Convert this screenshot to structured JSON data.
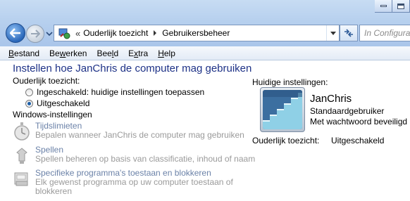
{
  "address": {
    "chevron": "«",
    "crumbs": [
      "Ouderlijk toezicht",
      "Gebruikersbeheer"
    ],
    "search_placeholder": "In Configuratiescherm zoeken"
  },
  "menu": {
    "items": [
      {
        "prefix": "",
        "underline": "B",
        "rest": "estand"
      },
      {
        "prefix": "Be",
        "underline": "w",
        "rest": "erken"
      },
      {
        "prefix": "Bee",
        "underline": "l",
        "rest": "d"
      },
      {
        "prefix": "E",
        "underline": "x",
        "rest": "tra"
      },
      {
        "prefix": "",
        "underline": "H",
        "rest": "elp"
      }
    ]
  },
  "main": {
    "title": "Instellen hoe JanChris de computer mag gebruiken",
    "parental_label": "Ouderlijk toezicht:",
    "radio_on": "Ingeschakeld: huidige instellingen toepassen",
    "radio_off": "Uitgeschakeld",
    "radio_selected": "off",
    "windows_settings_label": "Windows-instellingen",
    "settings": [
      {
        "link": "Tijdslimieten",
        "desc": "Bepalen wanneer JanChris de computer mag gebruiken",
        "icon": "stopwatch-icon"
      },
      {
        "link": "Spellen",
        "desc": "Spellen beheren op basis van classificatie, inhoud of naam",
        "icon": "game-controller-icon"
      },
      {
        "link": "Specifieke programma's toestaan en blokkeren",
        "desc": "Elk gewenst programma op uw computer toestaan of blokkeren",
        "icon": "program-block-icon"
      }
    ]
  },
  "current": {
    "label": "Huidige instellingen:",
    "user_name": "JanChris",
    "account_type": "Standaardgebruiker",
    "password_status": "Met wachtwoord beveiligd",
    "parental_label": "Ouderlijk toezicht:",
    "parental_value": "Uitgeschakeld"
  },
  "colors": {
    "title": "#1e3287",
    "link_disabled": "#6b82a8",
    "desc_disabled": "#9a9a9a"
  }
}
